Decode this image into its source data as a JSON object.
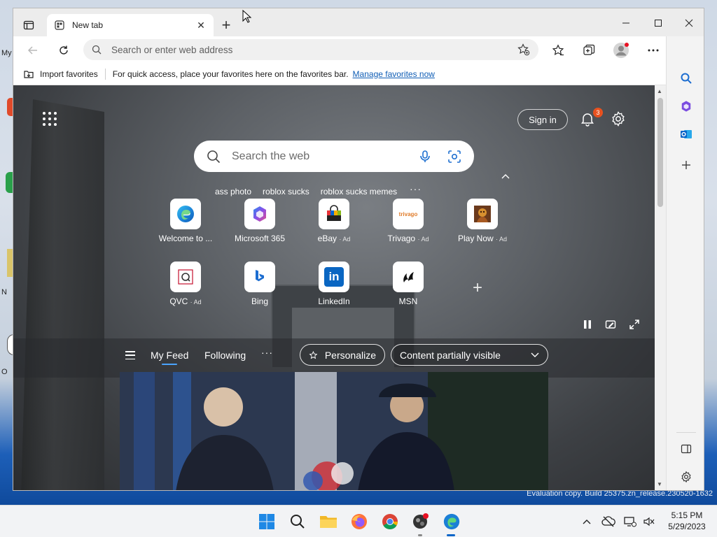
{
  "desktop": {
    "labels": [
      "My",
      "N",
      "O"
    ],
    "evaluation_text": "Evaluation copy. Build 25375.zn_release.230520-1632"
  },
  "browser": {
    "tab_title": "New tab",
    "address_placeholder": "Search or enter web address",
    "favorites_bar": {
      "import_label": "Import favorites",
      "message": "For quick access, place your favorites here on the favorites bar.",
      "manage_link": "Manage favorites now"
    }
  },
  "newtab": {
    "sign_in_label": "Sign in",
    "notification_count": "3",
    "search_placeholder": "Search the web",
    "suggestions": [
      "ass photo",
      "roblox sucks",
      "roblox sucks memes"
    ],
    "more_glyph": "···",
    "tiles": [
      {
        "label": "Welcome to ...",
        "ad": "",
        "icon": "edge-icon"
      },
      {
        "label": "Microsoft 365",
        "ad": "",
        "icon": "microsoft365-icon"
      },
      {
        "label": "eBay",
        "ad": "· Ad",
        "icon": "ebay-icon"
      },
      {
        "label": "Trivago",
        "ad": "· Ad",
        "icon": "trivago-icon"
      },
      {
        "label": "Play Now",
        "ad": "· Ad",
        "icon": "play-now-icon"
      },
      {
        "label": "QVC",
        "ad": "· Ad",
        "icon": "qvc-icon"
      },
      {
        "label": "Bing",
        "ad": "",
        "icon": "bing-icon"
      },
      {
        "label": "LinkedIn",
        "ad": "",
        "icon": "linkedin-icon"
      },
      {
        "label": "MSN",
        "ad": "",
        "icon": "msn-icon"
      }
    ],
    "trivago_logo_text": "trivago",
    "linkedin_logo_text": "in",
    "feed": {
      "tabs": [
        "My Feed",
        "Following"
      ],
      "personalize_label": "Personalize",
      "content_filter_label": "Content partially visible"
    }
  },
  "taskbar": {
    "time": "5:15 PM",
    "date": "5/29/2023"
  },
  "colors": {
    "accent": "#0f5db5",
    "badge": "#e8511f",
    "taskbar_active": "#0a64c8"
  }
}
